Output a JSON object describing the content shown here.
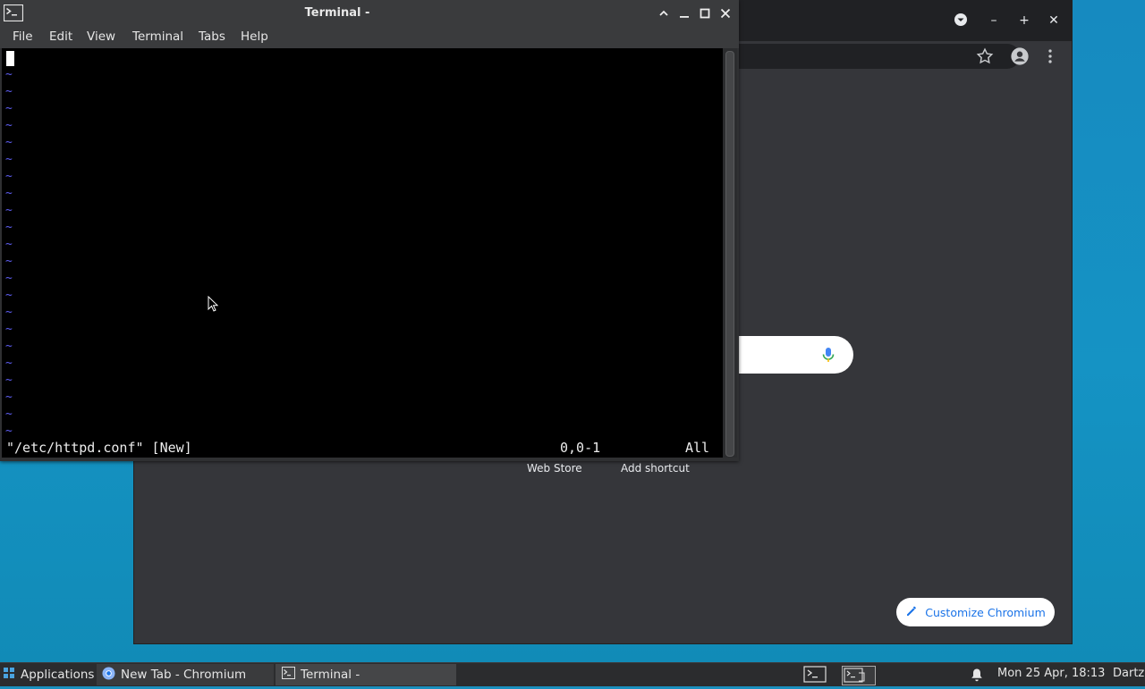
{
  "terminal": {
    "title": "Terminal -",
    "menu": [
      "File",
      "Edit",
      "View",
      "Terminal",
      "Tabs",
      "Help"
    ],
    "vim": {
      "tildes": "~\n~\n~\n~\n~\n~\n~\n~\n~\n~\n~\n~\n~\n~\n~\n~\n~\n~\n~\n~\n~\n~",
      "status_file": "\"/etc/httpd.conf\" [New]",
      "status_pos": "0,0-1",
      "status_all": "All"
    }
  },
  "chromium": {
    "shortcuts": [
      "Web Store",
      "Add shortcut"
    ],
    "customize_label": "Customize Chromium"
  },
  "taskbar": {
    "applications": "Applications",
    "tasks": [
      "New Tab - Chromium",
      "Terminal -"
    ],
    "clock": "Mon 25 Apr, 18:13",
    "user": "Dartz"
  }
}
